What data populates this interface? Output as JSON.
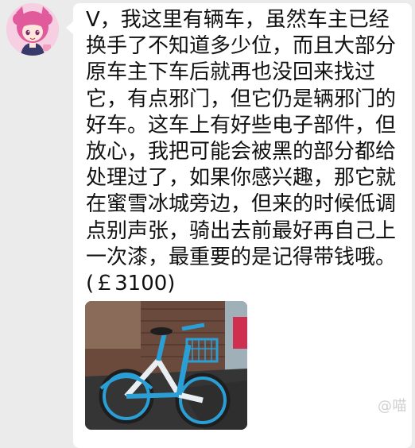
{
  "message": {
    "text": "V，我这里有辆车，虽然车主已经换手了不知道多少位，而且大部分原车主下车后就再也没回来找过它，有点邪门，但它仍是辆邪门的好车。这车上有好些电子部件，但放心，我把可能会被黑的部分都给处理过了，如果你感兴趣，那它就在蜜雪冰城旁边，但来的时候低调点别声张，骑出去前最好再自己上一次漆，最重要的是记得带钱哦。(￡3100)"
  },
  "watermark": {
    "text": "@喵"
  },
  "colors": {
    "page_background": "#ebebeb",
    "bubble_background": "#ffffff",
    "bike_frame": "#2a9fd6",
    "text": "#111111"
  },
  "icons": {
    "avatar": "anime-pink-hair-avatar",
    "photo": "shared-bicycle-photo"
  }
}
